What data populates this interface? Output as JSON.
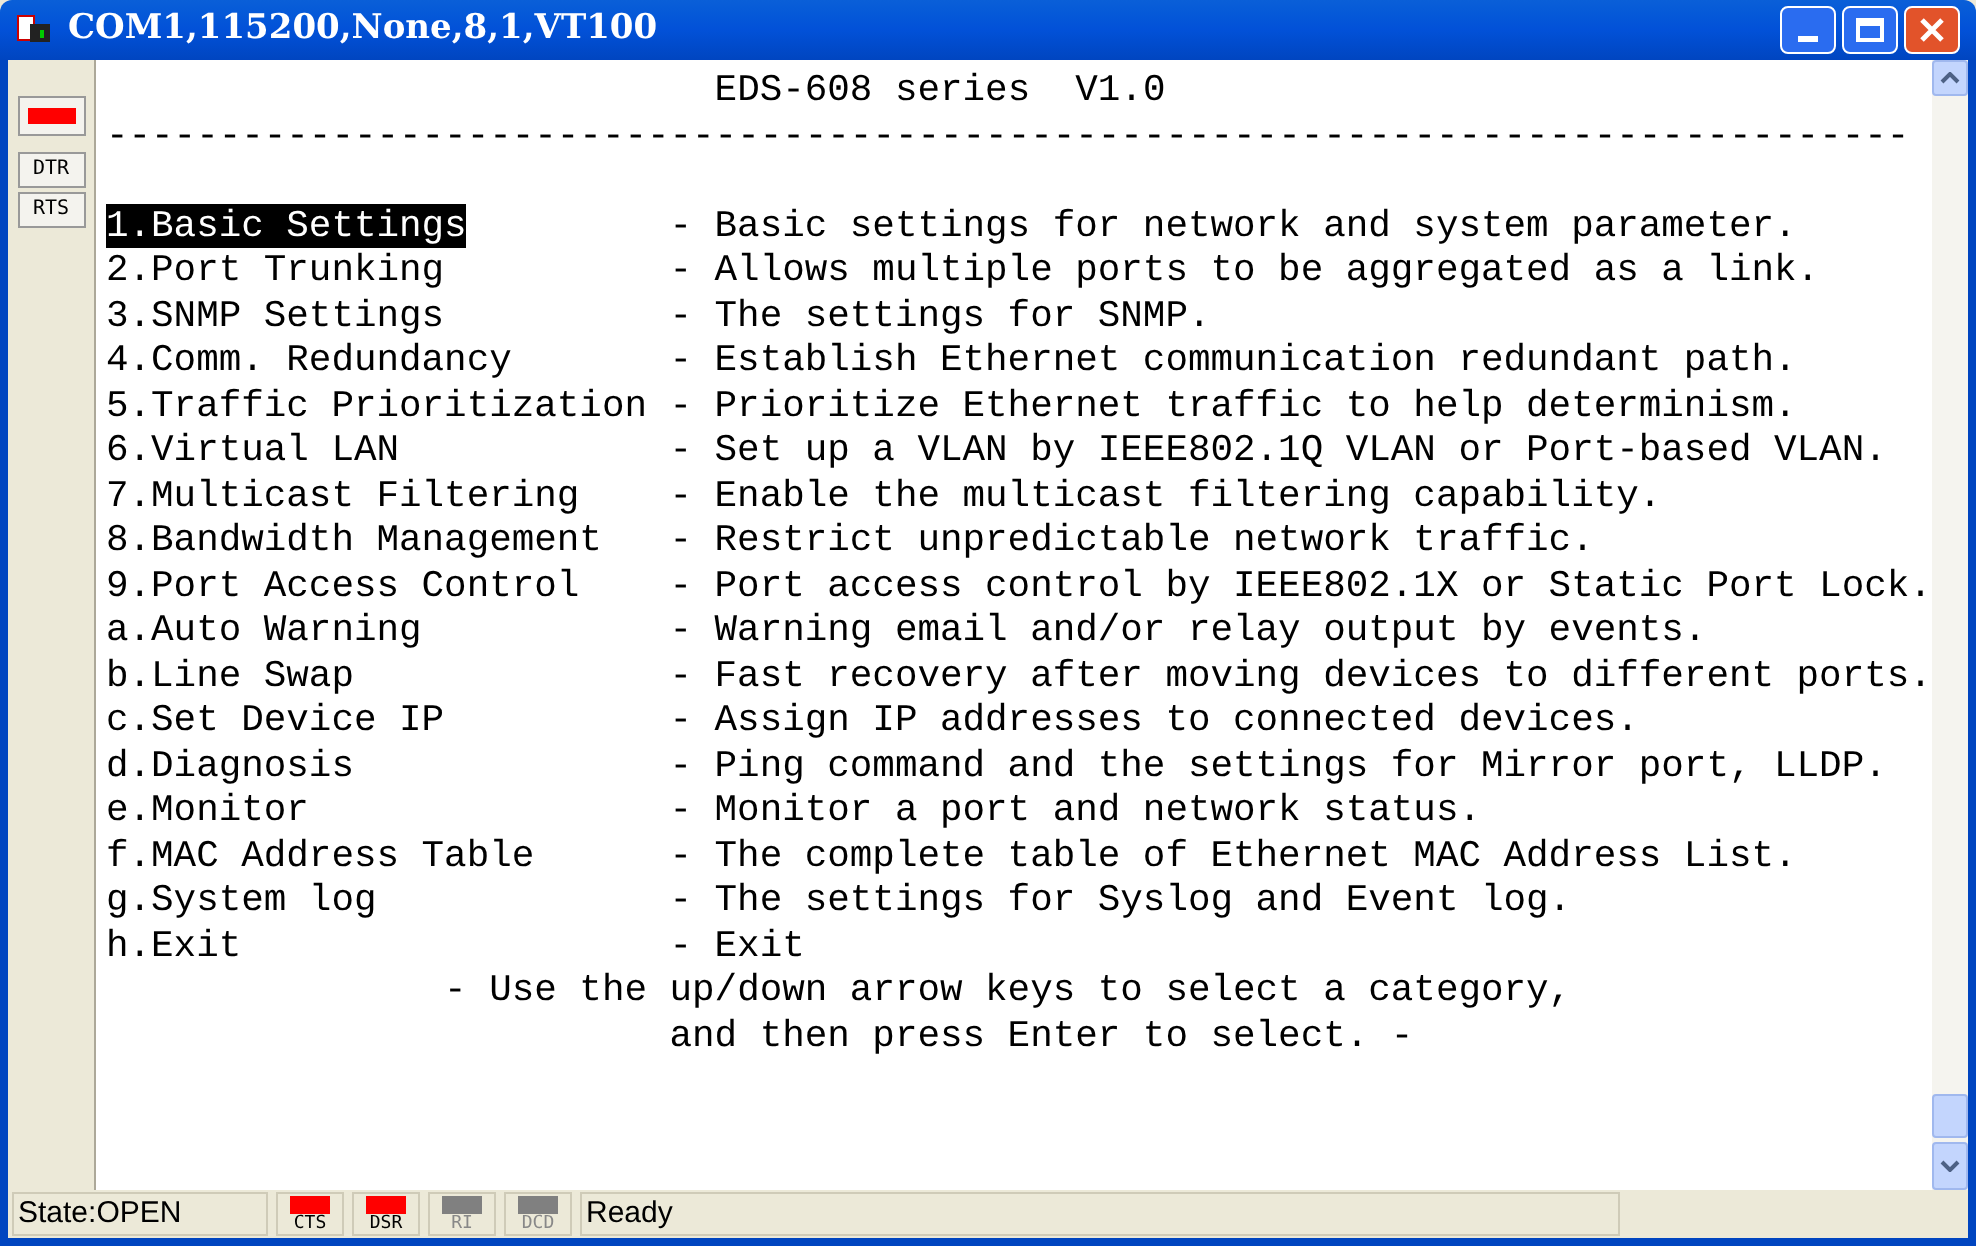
{
  "window": {
    "title": "COM1,115200,None,8,1,VT100"
  },
  "side_panel": {
    "indicator_on": true,
    "buttons": [
      "DTR",
      "RTS"
    ]
  },
  "terminal": {
    "header": "EDS-608 series  V1.0",
    "rule": "--------------------------------------------------------------------------------",
    "menu": [
      {
        "label": "1.Basic Settings",
        "description": "- Basic settings for network and system parameter.",
        "selected": true
      },
      {
        "label": "2.Port Trunking",
        "description": "- Allows multiple ports to be aggregated as a link.",
        "selected": false
      },
      {
        "label": "3.SNMP Settings",
        "description": "- The settings for SNMP.",
        "selected": false
      },
      {
        "label": "4.Comm. Redundancy",
        "description": "- Establish Ethernet communication redundant path.",
        "selected": false
      },
      {
        "label": "5.Traffic Prioritization",
        "description": "- Prioritize Ethernet traffic to help determinism.",
        "selected": false
      },
      {
        "label": "6.Virtual LAN",
        "description": "- Set up a VLAN by IEEE802.1Q VLAN or Port-based VLAN.",
        "selected": false
      },
      {
        "label": "7.Multicast Filtering",
        "description": "- Enable the multicast filtering capability.",
        "selected": false
      },
      {
        "label": "8.Bandwidth Management",
        "description": "- Restrict unpredictable network traffic.",
        "selected": false
      },
      {
        "label": "9.Port Access Control",
        "description": "- Port access control by IEEE802.1X or Static Port Lock.",
        "selected": false
      },
      {
        "label": "a.Auto Warning",
        "description": "- Warning email and/or relay output by events.",
        "selected": false
      },
      {
        "label": "b.Line Swap",
        "description": "- Fast recovery after moving devices to different ports.",
        "selected": false
      },
      {
        "label": "c.Set Device IP",
        "description": "- Assign IP addresses to connected devices.",
        "selected": false
      },
      {
        "label": "d.Diagnosis",
        "description": "- Ping command and the settings for Mirror port, LLDP.",
        "selected": false
      },
      {
        "label": "e.Monitor",
        "description": "- Monitor a port and network status.",
        "selected": false
      },
      {
        "label": "f.MAC Address Table",
        "description": "- The complete table of Ethernet MAC Address List.",
        "selected": false
      },
      {
        "label": "g.System log",
        "description": "- The settings for Syslog and Event log.",
        "selected": false
      },
      {
        "label": "h.Exit",
        "description": "- Exit",
        "selected": false
      }
    ],
    "footer": [
      "- Use the up/down arrow keys to select a category,",
      "and then press Enter to select. -"
    ]
  },
  "status_bar": {
    "state": "State:OPEN",
    "leds": [
      {
        "label": "CTS",
        "on": true
      },
      {
        "label": "DSR",
        "on": true
      },
      {
        "label": "RI",
        "on": false
      },
      {
        "label": "DCD",
        "on": false
      }
    ],
    "message": "Ready"
  }
}
